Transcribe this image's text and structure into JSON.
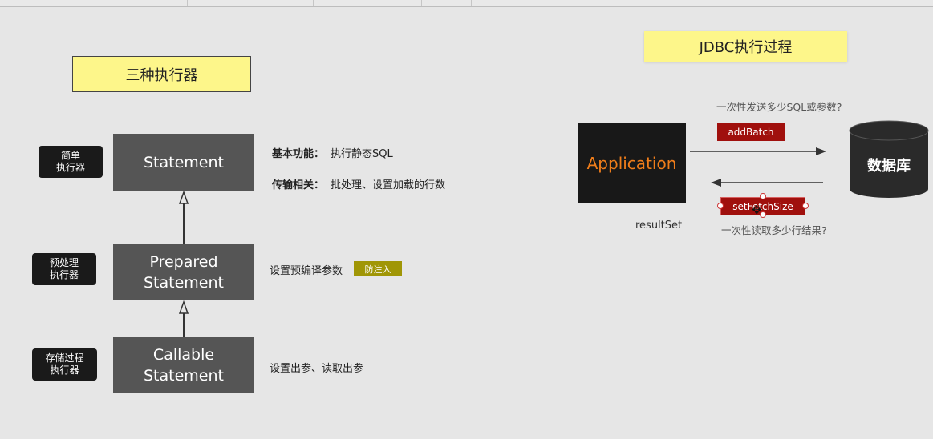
{
  "left_diagram": {
    "title": "三种执行器",
    "executors": [
      {
        "side_label": "简单\n执行器",
        "box_label": "Statement",
        "descriptions": [
          {
            "key": "基本功能：",
            "value": "执行静态SQL"
          },
          {
            "key": "传输相关：",
            "value": "批处理、设置加载的行数"
          }
        ]
      },
      {
        "side_label": "预处理\n执行器",
        "box_label": "Prepared\nStatement",
        "description": "设置预编译参数",
        "tag": "防注入"
      },
      {
        "side_label": "存储过程\n执行器",
        "box_label": "Callable\nStatement",
        "description": "设置出参、读取出参"
      }
    ]
  },
  "right_diagram": {
    "title": "JDBC执行过程",
    "app_label": "Application",
    "database_label": "数据库",
    "send_note": "一次性发送多少SQL或参数?",
    "send_tag": "addBatch",
    "fetch_tag": "setFetchSize",
    "read_note": "一次性读取多少行结果?",
    "result_label": "resultSet"
  },
  "icons": {
    "cursor": "move-cursor-icon",
    "database": "database-cylinder-icon"
  },
  "colors": {
    "background": "#e6e6e6",
    "title_yellow": "#fdf68a",
    "executor_box": "#555555",
    "side_label": "#1a1a1a",
    "app_text": "#ef7d1a",
    "tag_red": "#a0100d",
    "tag_olive": "#a09606"
  }
}
